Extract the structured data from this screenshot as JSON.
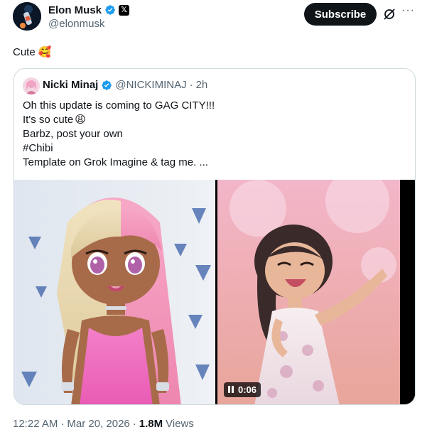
{
  "author": {
    "name": "Elon Musk",
    "handle": "@elonmusk",
    "avatar": "elon-avatar",
    "verified_badge": "verified-icon",
    "affiliate_badge": "x-logo-icon",
    "x_glyph": "𝕏"
  },
  "actions": {
    "subscribe_label": "Subscribe",
    "grok_icon": "grok-icon",
    "more_label": "···"
  },
  "tweet": {
    "text": "Cute",
    "emoji": "🥰"
  },
  "quote": {
    "name": "Nicki Minaj",
    "handle": "@NICKIMINAJ",
    "separator": "·",
    "time": "2h",
    "lines": [
      "Oh this update is coming to GAG CITY!!!",
      "It's so cute",
      "Barbz, post your own",
      "#Chibi",
      "Template on Grok Imagine & tag me. ..."
    ],
    "line2_emoji": "😩",
    "video_duration": "0:06"
  },
  "meta": {
    "time": "12:22 AM",
    "separator1": "·",
    "date": "Mar 20, 2026",
    "separator2": "·",
    "views_count": "1.8M",
    "views_label": "Views"
  },
  "colors": {
    "accent_blue": "#1d9bf0",
    "text_primary": "#0f1419",
    "text_secondary": "#536471",
    "border": "#cfd9de"
  }
}
